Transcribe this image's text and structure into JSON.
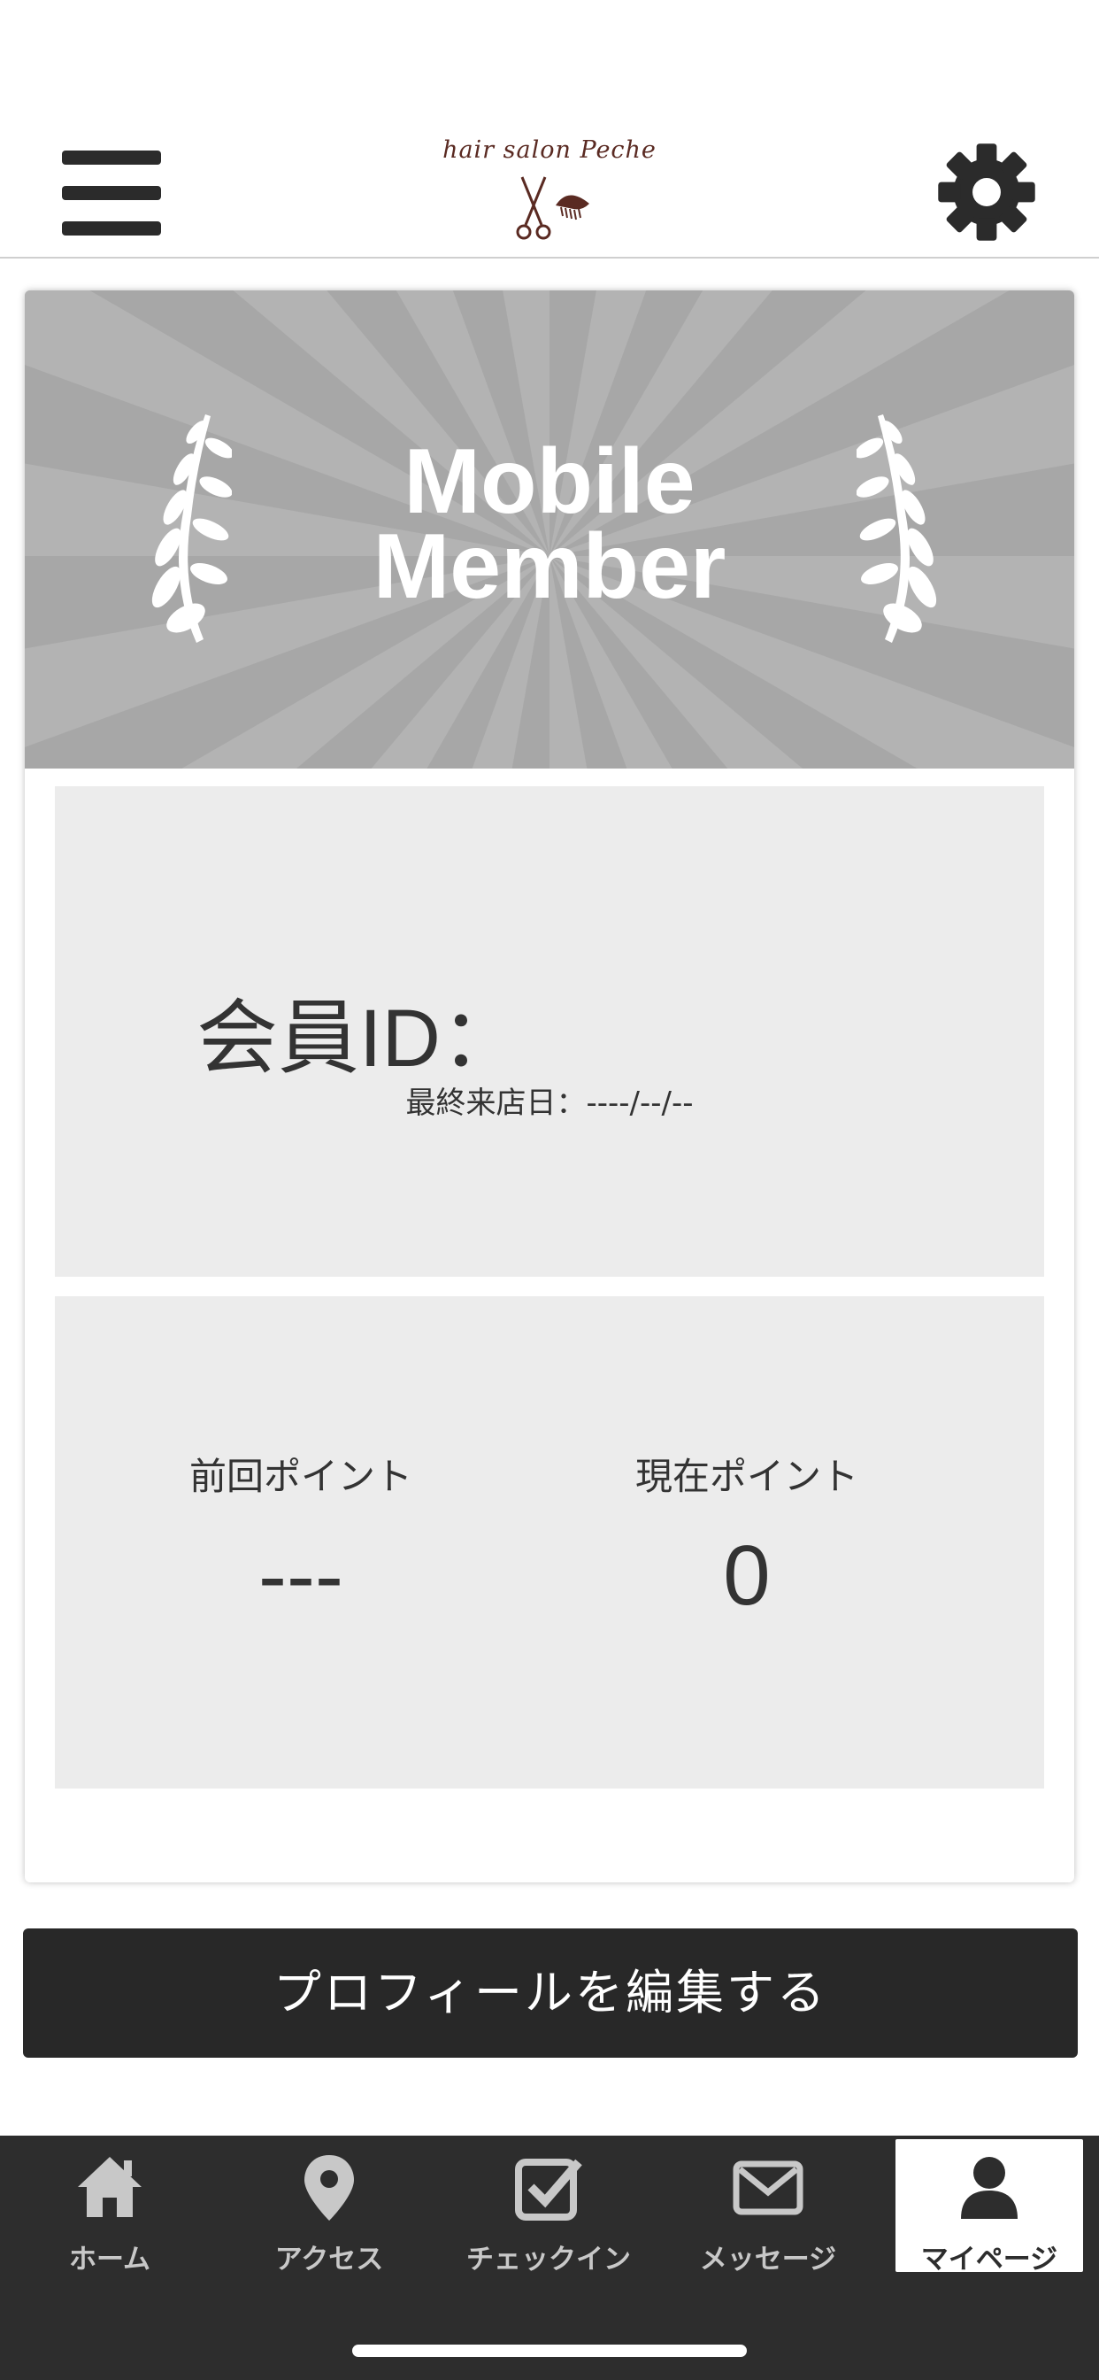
{
  "header": {
    "logo_text": "hair salon Peche",
    "menu_icon": "hamburger-menu-icon",
    "settings_icon": "gear-icon"
  },
  "banner": {
    "title_line1": "Mobile",
    "title_line2": "Member"
  },
  "member": {
    "id_label": "会員ID：",
    "last_visit": "最終来店日：----/--/--"
  },
  "points": {
    "previous_label": "前回ポイント",
    "previous_value": "---",
    "current_label": "現在ポイント",
    "current_value": "0"
  },
  "edit_profile_label": "プロフィールを編集する",
  "tabs": [
    {
      "label": "ホーム",
      "icon": "home-icon"
    },
    {
      "label": "アクセス",
      "icon": "map-pin-icon"
    },
    {
      "label": "チェックイン",
      "icon": "checkbox-icon"
    },
    {
      "label": "メッセージ",
      "icon": "envelope-icon"
    },
    {
      "label": "マイページ",
      "icon": "user-icon",
      "active": true
    }
  ],
  "colors": {
    "banner_bg": "#a7a7a7",
    "box_bg": "#ececec",
    "button_bg": "#282828",
    "tabbar_bg": "#2d2d2d",
    "logo_color": "#5a2a22"
  }
}
